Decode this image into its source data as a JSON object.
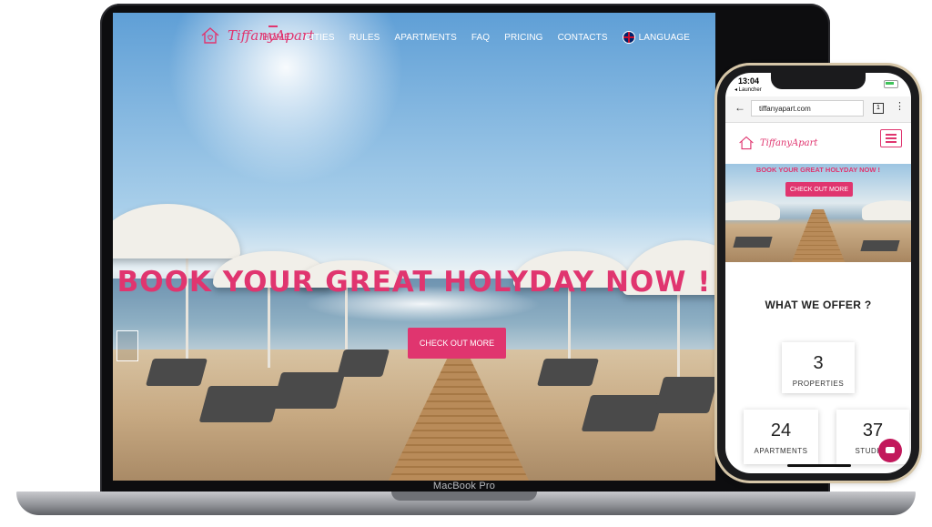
{
  "desktop": {
    "logo_text": "TiffanyApart",
    "nav": [
      "HOME",
      "CITIES",
      "RULES",
      "APARTMENTS",
      "FAQ",
      "PRICING",
      "CONTACTS"
    ],
    "language_label": "LANGUAGE",
    "hero_title": "BOOK YOUR GREAT HOLYDAY NOW !",
    "hero_button": "CHECK OUT MORE",
    "device_label": "MacBook Pro"
  },
  "phone": {
    "status_time": "13:04",
    "status_sub": "◂ Launcher",
    "url": "tiffanyapart.com",
    "tab_count": "1",
    "logo_text": "TiffanyApart",
    "hero_title": "BOOK YOUR GREAT HOLYDAY NOW !",
    "hero_button": "CHECK OUT MORE",
    "offer_title": "WHAT WE OFFER ?",
    "stats": [
      {
        "value": "3",
        "label": "PROPERTIES"
      },
      {
        "value": "24",
        "label": "APARTMENTS"
      },
      {
        "value": "37",
        "label": "STUDIOS"
      }
    ]
  },
  "colors": {
    "accent": "#e0356f"
  }
}
